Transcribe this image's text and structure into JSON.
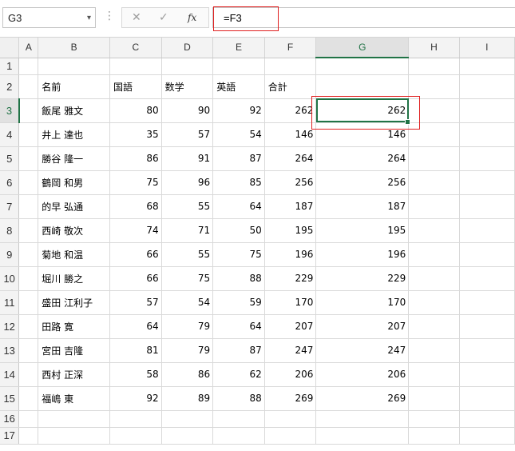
{
  "name_box": "G3",
  "formula_bar": {
    "cancel_icon": "✕",
    "enter_icon": "✓",
    "function_icon": "fx",
    "formula": "=F3"
  },
  "columns": [
    "A",
    "B",
    "C",
    "D",
    "E",
    "F",
    "G",
    "H",
    "I"
  ],
  "active_column": "G",
  "active_row": 3,
  "rows": [
    {
      "num": "1",
      "B": "",
      "C": "",
      "D": "",
      "E": "",
      "F": "",
      "G": ""
    },
    {
      "num": "2",
      "B": "名前",
      "C": "国語",
      "D": "数学",
      "E": "英語",
      "F": "合計",
      "G": ""
    },
    {
      "num": "3",
      "B": "飯尾 雅文",
      "C": "80",
      "D": "90",
      "E": "92",
      "F": "262",
      "G": "262"
    },
    {
      "num": "4",
      "B": "井上 達也",
      "C": "35",
      "D": "57",
      "E": "54",
      "F": "146",
      "G": "146"
    },
    {
      "num": "5",
      "B": "勝谷 隆一",
      "C": "86",
      "D": "91",
      "E": "87",
      "F": "264",
      "G": "264"
    },
    {
      "num": "6",
      "B": "鶴岡 和男",
      "C": "75",
      "D": "96",
      "E": "85",
      "F": "256",
      "G": "256"
    },
    {
      "num": "7",
      "B": "的早 弘通",
      "C": "68",
      "D": "55",
      "E": "64",
      "F": "187",
      "G": "187"
    },
    {
      "num": "8",
      "B": "西崎 敬次",
      "C": "74",
      "D": "71",
      "E": "50",
      "F": "195",
      "G": "195"
    },
    {
      "num": "9",
      "B": "菊地 和温",
      "C": "66",
      "D": "55",
      "E": "75",
      "F": "196",
      "G": "196"
    },
    {
      "num": "10",
      "B": "堀川 勝之",
      "C": "66",
      "D": "75",
      "E": "88",
      "F": "229",
      "G": "229"
    },
    {
      "num": "11",
      "B": "盛田 江利子",
      "C": "57",
      "D": "54",
      "E": "59",
      "F": "170",
      "G": "170"
    },
    {
      "num": "12",
      "B": "田路 寛",
      "C": "64",
      "D": "79",
      "E": "64",
      "F": "207",
      "G": "207"
    },
    {
      "num": "13",
      "B": "宮田 吉隆",
      "C": "81",
      "D": "79",
      "E": "87",
      "F": "247",
      "G": "247"
    },
    {
      "num": "14",
      "B": "西村 正深",
      "C": "58",
      "D": "86",
      "E": "62",
      "F": "206",
      "G": "206"
    },
    {
      "num": "15",
      "B": "福嶋 東",
      "C": "92",
      "D": "89",
      "E": "88",
      "F": "269",
      "G": "269"
    },
    {
      "num": "16",
      "B": "",
      "C": "",
      "D": "",
      "E": "",
      "F": "",
      "G": ""
    },
    {
      "num": "17",
      "B": "",
      "C": "",
      "D": "",
      "E": "",
      "F": "",
      "G": ""
    }
  ],
  "colors": {
    "selection": "#217346",
    "highlight": "#e02020"
  }
}
